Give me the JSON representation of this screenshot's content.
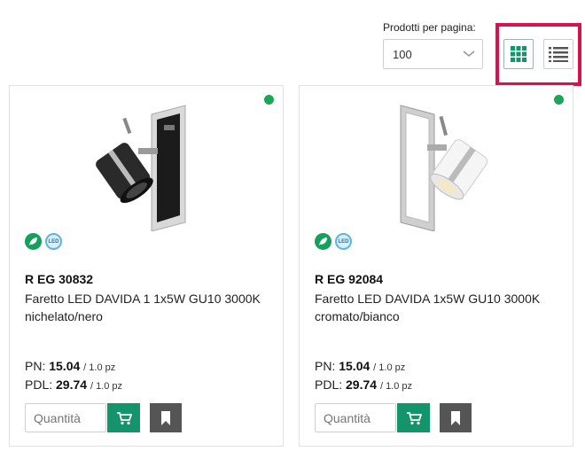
{
  "toolbar": {
    "per_page_label": "Prodotti per pagina:",
    "per_page_value": "100",
    "grid_icon": "grid-view-icon",
    "list_icon": "list-view-icon"
  },
  "colors": {
    "accent_green": "#13946a",
    "status_green": "#1aa75a",
    "highlight_red": "#d8124f",
    "bookmark_gray": "#555555"
  },
  "products": [
    {
      "code": "R EG 30832",
      "description": "Faretto LED DAVIDA 1 1x5W GU10 3000K nichelato/nero",
      "pn_label": "PN:",
      "pn_value": "15.04",
      "pn_unit": "/ 1.0 pz",
      "pdl_label": "PDL:",
      "pdl_value": "29.74",
      "pdl_unit": "/ 1.0 pz",
      "qty_placeholder": "Quantità",
      "badge_eco": "eco-leaf-icon",
      "badge_led": "LED"
    },
    {
      "code": "R EG 92084",
      "description": "Faretto LED DAVIDA 1x5W GU10 3000K cromato/bianco",
      "pn_label": "PN:",
      "pn_value": "15.04",
      "pn_unit": "/ 1.0 pz",
      "pdl_label": "PDL:",
      "pdl_value": "29.74",
      "pdl_unit": "/ 1.0 pz",
      "qty_placeholder": "Quantità",
      "badge_eco": "eco-leaf-icon",
      "badge_led": "LED"
    }
  ]
}
